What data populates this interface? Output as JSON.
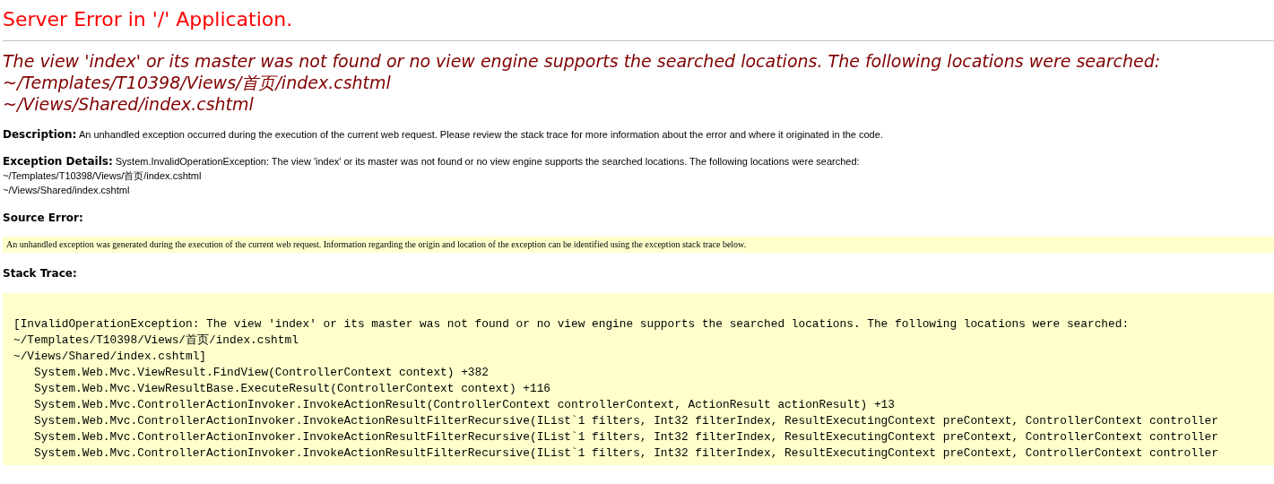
{
  "title": "Server Error in '/' Application.",
  "message": {
    "lines": [
      "The view 'index' or its master was not found or no view engine supports the searched locations. The following locations were searched:",
      "~/Templates/T10398/Views/首页/index.cshtml",
      "~/Views/Shared/index.cshtml"
    ]
  },
  "description": {
    "label": "Description:",
    "text": "An unhandled exception occurred during the execution of the current web request. Please review the stack trace for more information about the error and where it originated in the code."
  },
  "exception_details": {
    "label": "Exception Details:",
    "lines": [
      "System.InvalidOperationException: The view 'index' or its master was not found or no view engine supports the searched locations. The following locations were searched:",
      "~/Templates/T10398/Views/首页/index.cshtml",
      "~/Views/Shared/index.cshtml"
    ]
  },
  "source_error": {
    "label": "Source Error:",
    "code": "An unhandled exception was generated during the execution of the current web request. Information regarding the origin and location of the exception can be identified using the exception stack trace below."
  },
  "stack_trace": {
    "label": "Stack Trace:",
    "lines": [
      "[InvalidOperationException: The view 'index' or its master was not found or no view engine supports the searched locations. The following locations were searched:",
      "~/Templates/T10398/Views/首页/index.cshtml",
      "~/Views/Shared/index.cshtml]",
      "   System.Web.Mvc.ViewResult.FindView(ControllerContext context) +382",
      "   System.Web.Mvc.ViewResultBase.ExecuteResult(ControllerContext context) +116",
      "   System.Web.Mvc.ControllerActionInvoker.InvokeActionResult(ControllerContext controllerContext, ActionResult actionResult) +13",
      "   System.Web.Mvc.ControllerActionInvoker.InvokeActionResultFilterRecursive(IList`1 filters, Int32 filterIndex, ResultExecutingContext preContext, ControllerContext controller",
      "   System.Web.Mvc.ControllerActionInvoker.InvokeActionResultFilterRecursive(IList`1 filters, Int32 filterIndex, ResultExecutingContext preContext, ControllerContext controller",
      "   System.Web.Mvc.ControllerActionInvoker.InvokeActionResultFilterRecursive(IList`1 filters, Int32 filterIndex, ResultExecutingContext preContext, ControllerContext controller"
    ]
  }
}
